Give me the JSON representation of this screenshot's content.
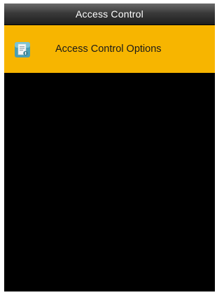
{
  "header": {
    "title": "Access Control"
  },
  "menu": {
    "items": [
      {
        "label": "Access Control Options",
        "icon": "access-control-document-icon",
        "selected": true
      }
    ]
  },
  "colors": {
    "screen_background": "#000000",
    "selection_highlight": "#f7b500",
    "title_text": "#ffffff",
    "item_text": "#1a1a1a"
  }
}
